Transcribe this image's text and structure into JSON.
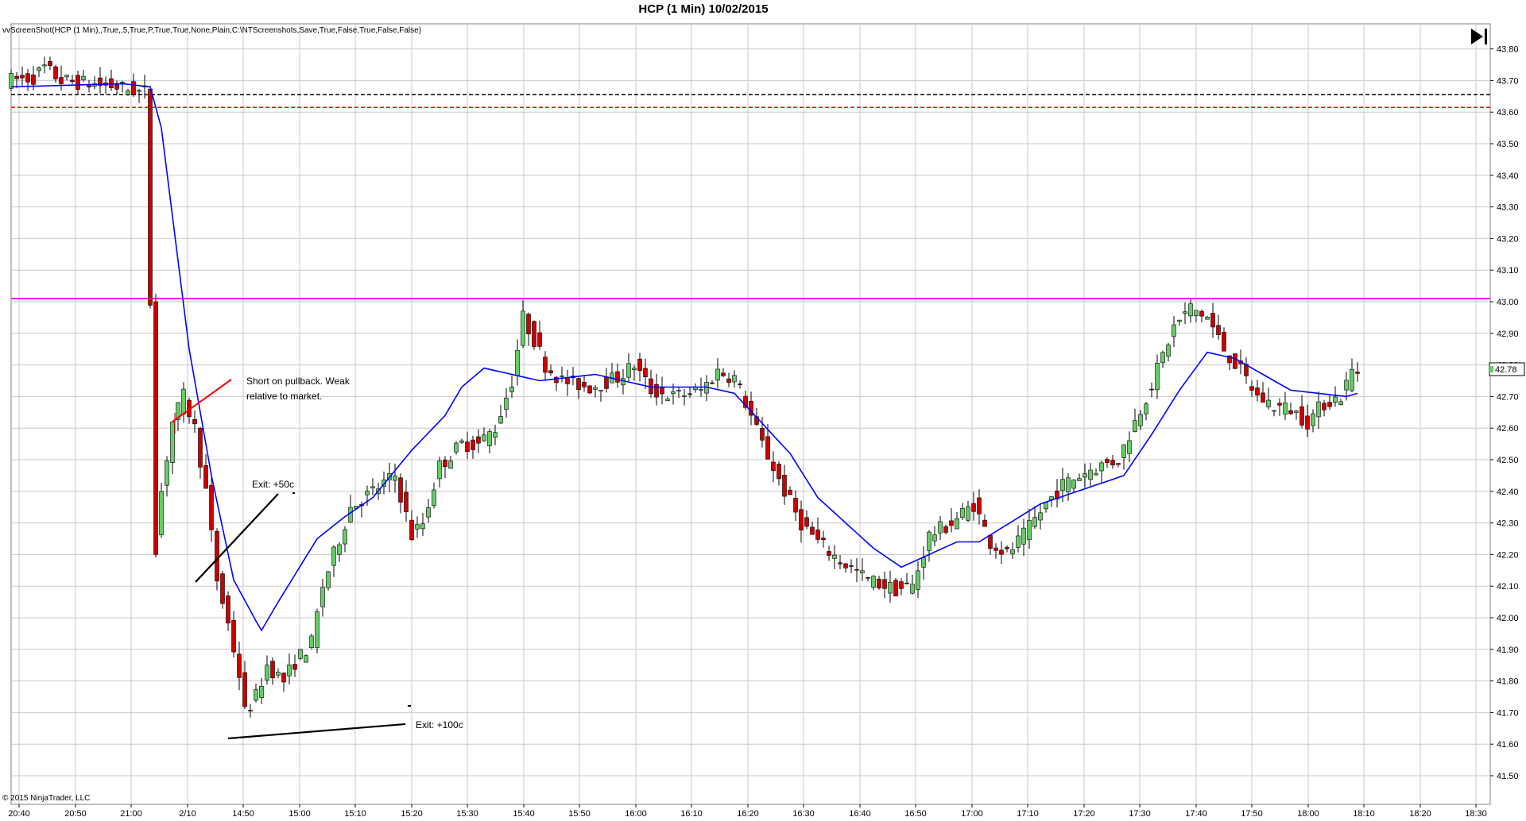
{
  "header": {
    "title": "HCP (1 Min)  10/02/2015",
    "strategy_text": "vvScreenShot(HCP (1 Min),,True,,5,True,P,True,True,None,Plain,C:\\NTScreenshots,Save,True,False,True,False,False)",
    "copyright": "© 2015 NinjaTrader, LLC",
    "last_price_label": "42.78"
  },
  "annotations": {
    "short_note_line1": "Short on pullback. Weak",
    "short_note_line2": "relative to market.",
    "exit1_label": "Exit: +50c",
    "exit2_label": "Exit: +100c"
  },
  "icons": {
    "play_end": "skip-to-end-icon"
  },
  "colors": {
    "up_candle": "#66cc66",
    "down_candle": "#cc0000",
    "ma_line": "#0000ff",
    "resistance": "#ff00ff",
    "dash_black": "#000000",
    "dash_red": "#ff0000",
    "grid": "#c8c8c8"
  },
  "chart_data": {
    "type": "candlestick",
    "y_range": [
      41.45,
      43.85
    ],
    "y_ticks": [
      "43.80",
      "43.70",
      "43.60",
      "43.50",
      "43.40",
      "43.30",
      "43.20",
      "43.10",
      "43.00",
      "42.90",
      "42.80",
      "42.70",
      "42.60",
      "42.50",
      "42.40",
      "42.30",
      "42.20",
      "42.10",
      "42.00",
      "41.90",
      "41.80",
      "41.70",
      "41.60",
      "41.50"
    ],
    "x_ticks": [
      "20:40",
      "20:50",
      "21:00",
      "2/10",
      "14:50",
      "15:00",
      "15:10",
      "15:20",
      "15:30",
      "15:40",
      "15:50",
      "16:00",
      "16:10",
      "16:20",
      "16:30",
      "16:40",
      "16:50",
      "17:00",
      "17:10",
      "17:20",
      "17:30",
      "17:40",
      "17:50",
      "18:00",
      "18:10",
      "18:20",
      "18:30"
    ],
    "levels": {
      "magenta": 43.01,
      "black_dashed": 43.655,
      "red_dashed": 43.615
    },
    "ma_knots": [
      [
        0,
        43.68
      ],
      [
        20,
        43.69
      ],
      [
        25,
        43.68
      ],
      [
        27,
        43.55
      ],
      [
        32,
        42.85
      ],
      [
        36,
        42.45
      ],
      [
        40,
        42.12
      ],
      [
        44,
        41.99
      ],
      [
        45,
        41.96
      ],
      [
        48,
        42.05
      ],
      [
        55,
        42.25
      ],
      [
        60,
        42.32
      ],
      [
        65,
        42.38
      ],
      [
        72,
        42.53
      ],
      [
        78,
        42.64
      ],
      [
        81,
        42.73
      ],
      [
        85,
        42.79
      ],
      [
        95,
        42.75
      ],
      [
        105,
        42.77
      ],
      [
        115,
        42.73
      ],
      [
        125,
        42.73
      ],
      [
        130,
        42.71
      ],
      [
        140,
        42.52
      ],
      [
        145,
        42.38
      ],
      [
        155,
        42.22
      ],
      [
        160,
        42.16
      ],
      [
        170,
        42.24
      ],
      [
        174,
        42.24
      ],
      [
        185,
        42.36
      ],
      [
        200,
        42.45
      ],
      [
        205,
        42.58
      ],
      [
        210,
        42.72
      ],
      [
        215,
        42.84
      ],
      [
        220,
        42.82
      ],
      [
        225,
        42.77
      ],
      [
        230,
        42.72
      ],
      [
        240,
        42.7
      ],
      [
        242,
        42.71
      ]
    ]
  }
}
